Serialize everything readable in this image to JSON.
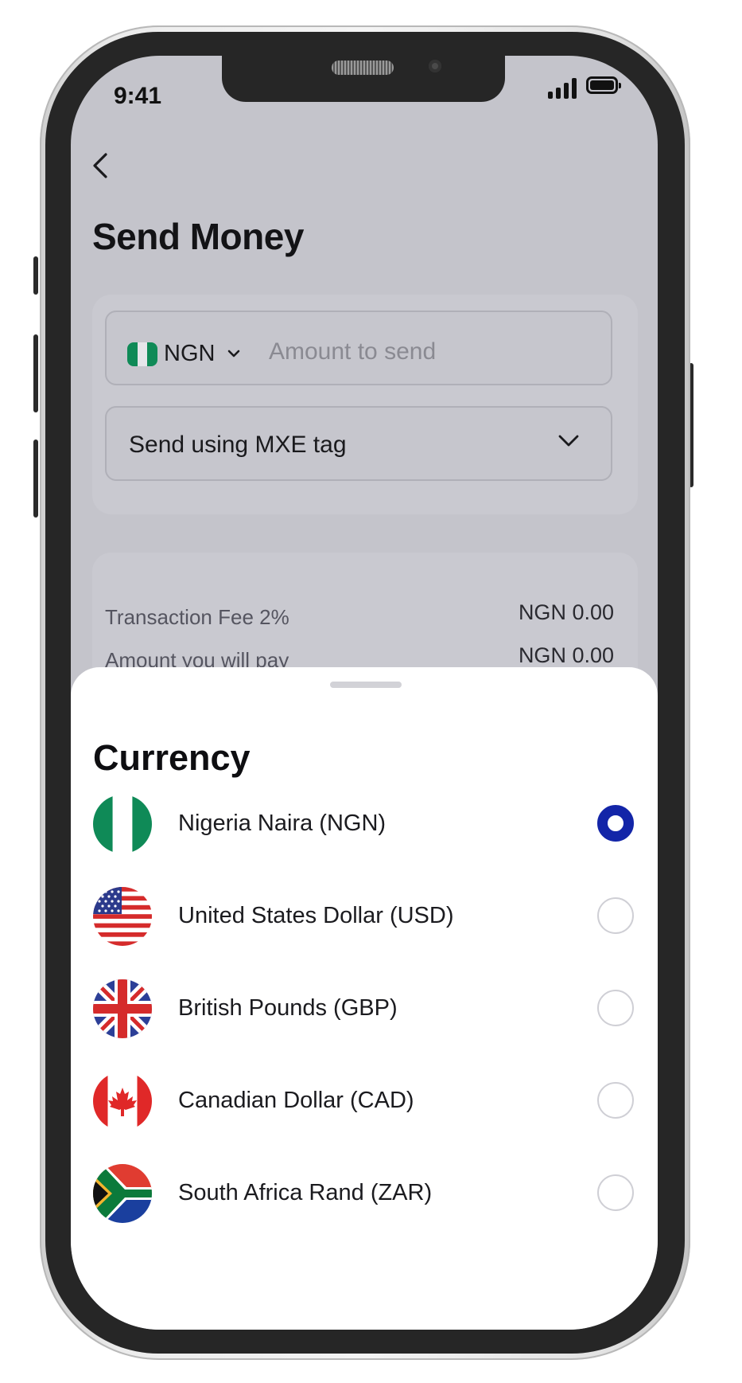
{
  "status_bar": {
    "time": "9:41"
  },
  "page": {
    "title": "Send Money",
    "amount_field": {
      "currency_code": "NGN",
      "placeholder": "Amount to send"
    },
    "method_field": {
      "label": "Send using MXE tag"
    },
    "fees": [
      {
        "label": "Transaction Fee 2%",
        "value": "NGN 0.00"
      },
      {
        "label": "Amount you will pay",
        "value": "NGN 0.00"
      }
    ]
  },
  "sheet": {
    "title": "Currency",
    "options": [
      {
        "label": "Nigeria Naira (NGN)",
        "flag": "nigeria-flag-icon",
        "selected": true
      },
      {
        "label": "United States Dollar (USD)",
        "flag": "usa-flag-icon",
        "selected": false
      },
      {
        "label": "British Pounds (GBP)",
        "flag": "uk-flag-icon",
        "selected": false
      },
      {
        "label": "Canadian Dollar (CAD)",
        "flag": "canada-flag-icon",
        "selected": false
      },
      {
        "label": "South Africa Rand (ZAR)",
        "flag": "south-africa-flag-icon",
        "selected": false
      }
    ]
  },
  "colors": {
    "accent": "#1325a8",
    "overlay_background": "#c4c4cb",
    "nigeria_green": "#0f8a57"
  }
}
